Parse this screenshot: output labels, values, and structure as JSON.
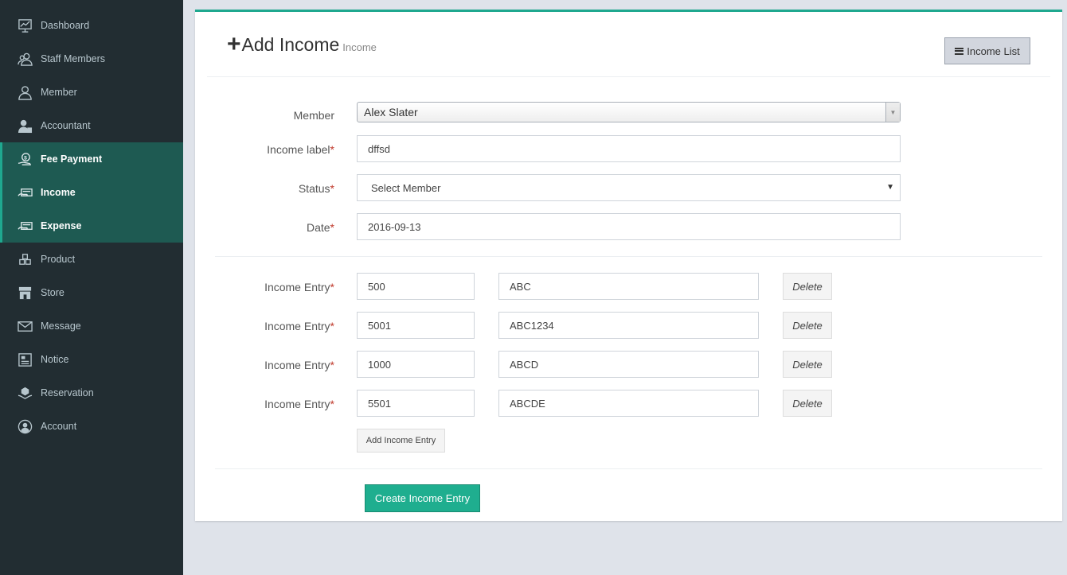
{
  "sidebar": {
    "items": [
      {
        "label": "Dashboard",
        "icon": "dashboard-icon"
      },
      {
        "label": "Staff Members",
        "icon": "staff-members-icon"
      },
      {
        "label": "Member",
        "icon": "member-icon"
      },
      {
        "label": "Accountant",
        "icon": "accountant-icon"
      },
      {
        "label": "Fee Payment",
        "icon": "fee-payment-icon"
      },
      {
        "label": "Income",
        "icon": "income-icon"
      },
      {
        "label": "Expense",
        "icon": "expense-icon"
      },
      {
        "label": "Product",
        "icon": "product-icon"
      },
      {
        "label": "Store",
        "icon": "store-icon"
      },
      {
        "label": "Message",
        "icon": "message-icon"
      },
      {
        "label": "Notice",
        "icon": "notice-icon"
      },
      {
        "label": "Reservation",
        "icon": "reservation-icon"
      },
      {
        "label": "Account",
        "icon": "account-icon"
      }
    ],
    "active_items": [
      "Fee Payment",
      "Income",
      "Expense"
    ]
  },
  "header": {
    "title": "Add Income",
    "subtitle": "Income",
    "list_button_label": "Income List"
  },
  "form": {
    "member": {
      "label": "Member",
      "value": "Alex Slater"
    },
    "income_label": {
      "label": "Income label",
      "value": "dffsd"
    },
    "status": {
      "label": "Status",
      "value": "Select Member"
    },
    "date": {
      "label": "Date",
      "value": "2016-09-13"
    },
    "required_marker": "*"
  },
  "entries": {
    "label": "Income Entry",
    "delete_label": "Delete",
    "rows": [
      {
        "amount": "500",
        "description": "ABC"
      },
      {
        "amount": "5001",
        "description": "ABC1234"
      },
      {
        "amount": "1000",
        "description": "ABCD"
      },
      {
        "amount": "5501",
        "description": "ABCDE"
      }
    ],
    "add_button_label": "Add Income Entry"
  },
  "submit_label": "Create Income Entry",
  "colors": {
    "sidebar_bg": "#222d32",
    "sidebar_active_bg": "#1e5a52",
    "accent": "#1fae8f",
    "page_bg": "#dfe3ea"
  }
}
